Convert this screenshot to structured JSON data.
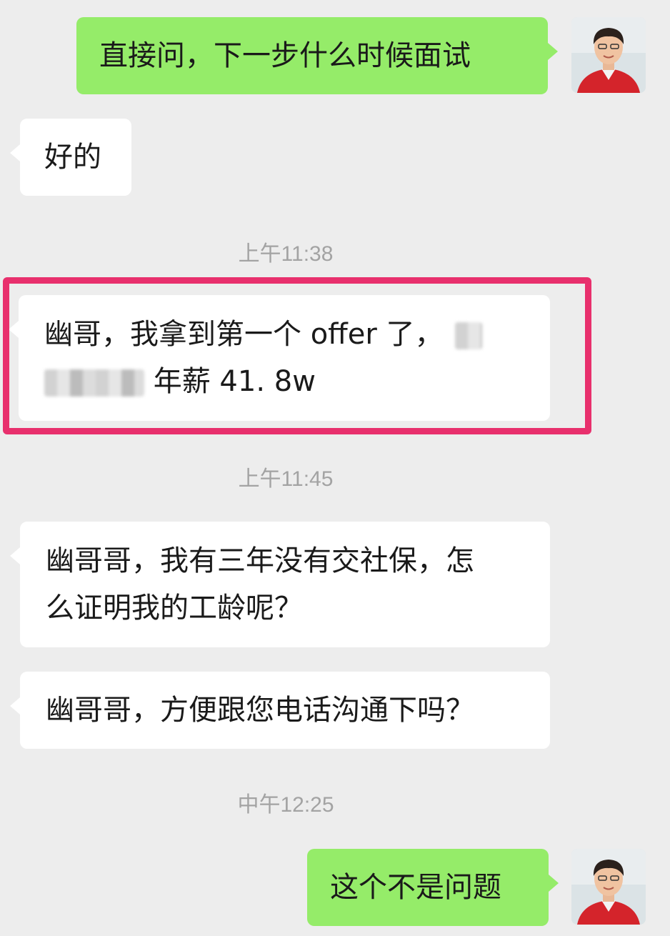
{
  "messages": {
    "m1": "直接问，下一步什么时候面试",
    "m2": "好的",
    "t1": "上午11:38",
    "m3_line1": "幽哥，我拿到第一个 offer 了，",
    "m3_line2": "年薪 41. 8w",
    "t2": "上午11:45",
    "m4_line1": "幽哥哥，我有三年没有交社保，怎",
    "m4_line2": "么证明我的工龄呢？",
    "m5": "幽哥哥，方便跟您电话沟通下吗？",
    "t3": "中午12:25",
    "m6": "这个不是问题"
  },
  "colors": {
    "background": "#ededed",
    "outgoing_bubble": "#95ec69",
    "incoming_bubble": "#ffffff",
    "highlight_border": "#e8306d",
    "timestamp": "#a3a3a3"
  },
  "icons": {
    "avatar": "avatar-icon",
    "redaction": "blurred-text"
  }
}
